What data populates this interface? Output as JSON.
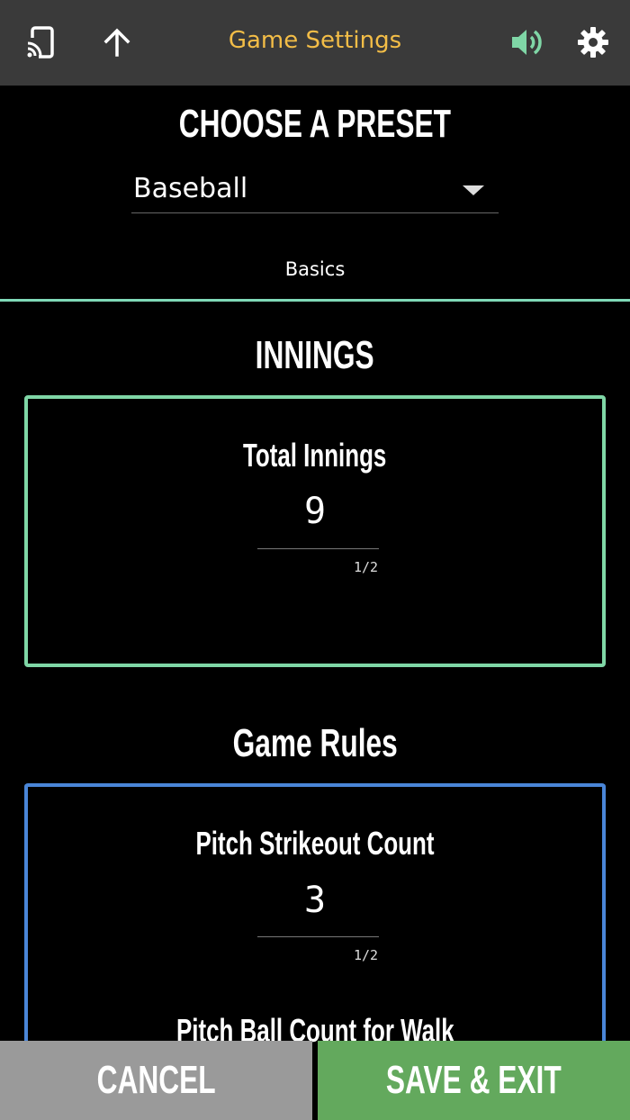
{
  "header": {
    "title": "Game Settings",
    "icons": [
      "cast-icon",
      "upload-arrow-icon",
      "volume-icon",
      "gear-icon"
    ],
    "title_color": "#f3bd47",
    "volume_color": "#7fd6a6"
  },
  "preset": {
    "heading": "CHOOSE A PRESET",
    "selected": "Baseball"
  },
  "tabs": [
    {
      "label": "Basics",
      "active": true
    }
  ],
  "innings_section": {
    "heading": "INNINGS",
    "fields": [
      {
        "label": "Total Innings",
        "value": "9",
        "hint": "1/2"
      }
    ],
    "border_color": "#7fd6a6"
  },
  "rules_section": {
    "heading": "Game Rules",
    "fields": [
      {
        "label": "Pitch Strikeout Count",
        "value": "3",
        "hint": "1/2"
      },
      {
        "label": "Pitch Ball Count for Walk"
      }
    ],
    "border_color": "#4a86d8"
  },
  "footer": {
    "cancel_label": "CANCEL",
    "save_label": "SAVE & EXIT",
    "cancel_color": "#9a9a9a",
    "save_color": "#63a95d"
  }
}
